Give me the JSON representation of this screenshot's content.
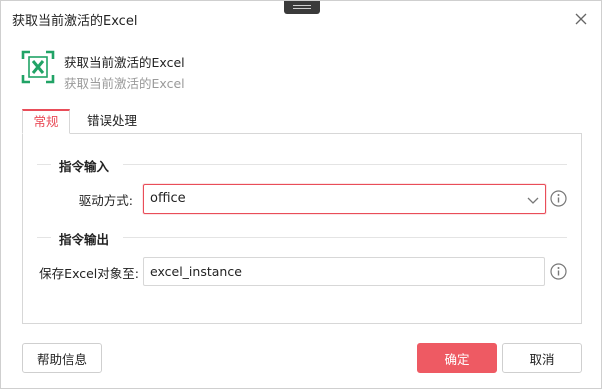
{
  "window": {
    "title": "获取当前激活的Excel"
  },
  "header": {
    "icon": "excel-icon",
    "name": "获取当前激活的Excel",
    "description": "获取当前激活的Excel"
  },
  "tabs": [
    {
      "label": "常规",
      "active": true
    },
    {
      "label": "错误处理",
      "active": false
    }
  ],
  "input_section": {
    "title": "指令输入",
    "fields": [
      {
        "label": "驱动方式:",
        "type": "select",
        "value": "office"
      }
    ]
  },
  "output_section": {
    "title": "指令输出",
    "fields": [
      {
        "label": "保存Excel对象至:",
        "type": "text",
        "value": "excel_instance"
      }
    ]
  },
  "buttons": {
    "help": "帮助信息",
    "ok": "确定",
    "cancel": "取消"
  },
  "colors": {
    "accent": "#e94d59",
    "primary_button": "#ee5a63",
    "excel_green": "#21a366",
    "border": "#d7d7d7"
  }
}
